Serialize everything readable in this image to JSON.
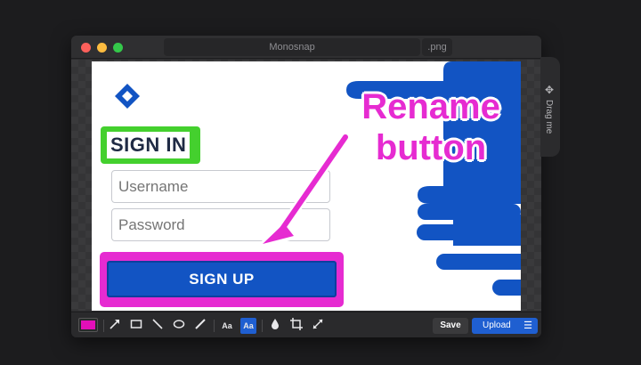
{
  "window": {
    "title": "Monosnap",
    "extension": ".png"
  },
  "drag_tab": {
    "icon": "move-icon",
    "label": "Drag me"
  },
  "screenshot": {
    "signin_label": "SIGN IN",
    "username_placeholder": "Username",
    "password_placeholder": "Password",
    "signup_label": "SIGN UP",
    "annotation_text_line1": "Rename",
    "annotation_text_line2": "button"
  },
  "toolbar": {
    "color": "#e30fb8",
    "tools": [
      "color-swatch",
      "arrow-icon",
      "rectangle-icon",
      "line-icon",
      "ellipse-icon",
      "pen-icon",
      "text-icon",
      "text-highlight-icon",
      "blur-drop-icon",
      "crop-icon",
      "resize-icon"
    ],
    "text_tool_label": "Aa",
    "save_label": "Save",
    "upload_label": "Upload"
  },
  "colors": {
    "accent_magenta": "#e62bd1",
    "brand_blue": "#1254c3",
    "highlight_green": "#44d02e"
  }
}
